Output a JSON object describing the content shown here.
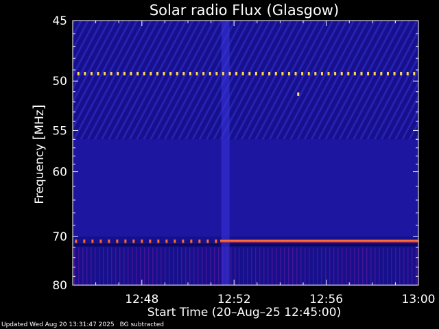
{
  "chart_data": {
    "type": "heatmap",
    "title": "Solar radio Flux (Glasgow)",
    "xlabel": "Start Time (20–Aug–25 12:45:00)",
    "ylabel_main": "Frequency ",
    "ylabel_unit": "MHz",
    "x_range_minutes": [
      0,
      15
    ],
    "x_ticks": [
      {
        "label": "12:48",
        "minutes": 3
      },
      {
        "label": "12:52",
        "minutes": 7
      },
      {
        "label": "12:56",
        "minutes": 11
      },
      {
        "label": "13:00",
        "minutes": 15
      }
    ],
    "y_scale": "reciprocal",
    "y_range_mhz": [
      45,
      80
    ],
    "y_ticks": [
      {
        "label": "45",
        "mhz": 45
      },
      {
        "label": "50",
        "mhz": 50
      },
      {
        "label": "55",
        "mhz": 55
      },
      {
        "label": "60",
        "mhz": 60
      },
      {
        "label": "70",
        "mhz": 70
      },
      {
        "label": "80",
        "mhz": 80
      }
    ],
    "features": [
      {
        "kind": "dotted-line",
        "mhz": 49.3,
        "x_start_min": 0.2,
        "x_end_min": 15,
        "color": "#ffd84a"
      },
      {
        "kind": "solid-line",
        "mhz": 70.8,
        "x_start_min": 6.4,
        "x_end_min": 15,
        "color": "#ff3a2a"
      },
      {
        "kind": "dotted-line",
        "mhz": 70.8,
        "x_start_min": 0.1,
        "x_end_min": 6.4,
        "color": "#ff6a2a"
      },
      {
        "kind": "point",
        "mhz": 51.2,
        "x_min": 9.8,
        "color": "#ffe060"
      }
    ],
    "colors": {
      "background": "#16108c",
      "band": "#2a22c8",
      "stripe": "#3a35e0",
      "hot": "#ff3a2a",
      "warm": "#ffd84a"
    },
    "grid": false
  },
  "footer": {
    "updated": "Updated Wed Aug 20 13:31:47 2025",
    "note": "BG subtracted"
  }
}
